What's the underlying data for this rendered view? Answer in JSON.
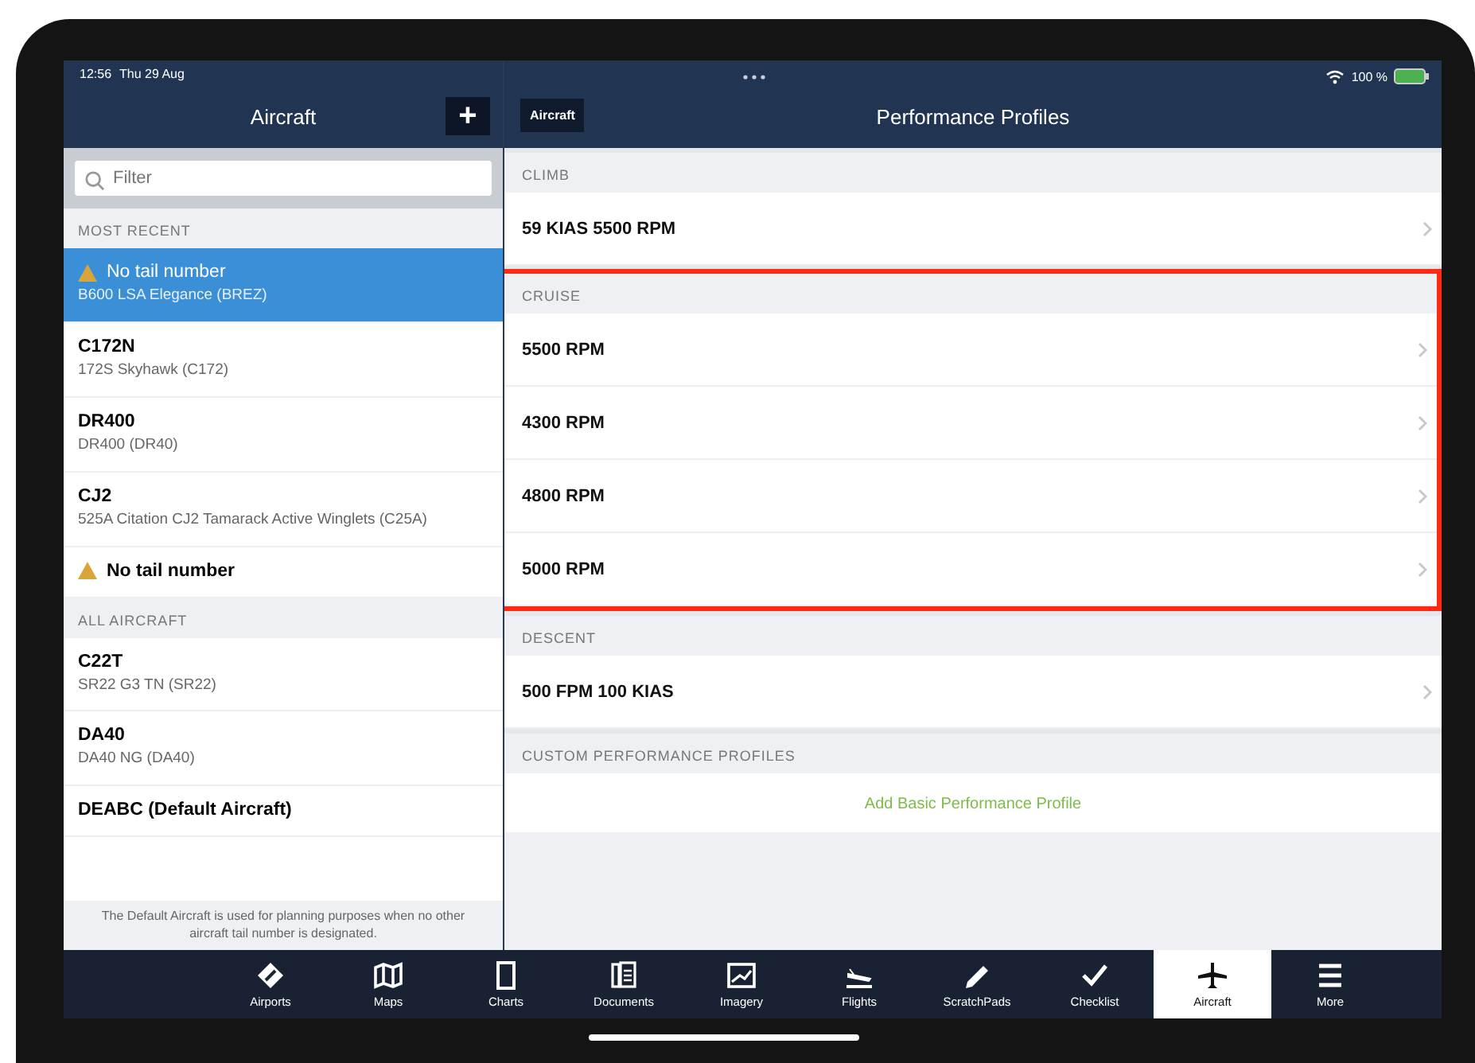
{
  "status_bar": {
    "time": "12:56",
    "date": "Thu 29 Aug",
    "battery": "100 %"
  },
  "sidebar": {
    "title": "Aircraft",
    "add_button": "+",
    "filter": {
      "placeholder": "Filter"
    },
    "sections": [
      {
        "heading": "MOST RECENT",
        "items": [
          {
            "title": "No tail number",
            "subtitle": "B600 LSA Elegance (BREZ)",
            "warning": true,
            "selected": true
          },
          {
            "title": "C172N",
            "subtitle": "172S Skyhawk (C172)",
            "warning": false,
            "selected": false
          },
          {
            "title": "DR400",
            "subtitle": "DR400 (DR40)",
            "warning": false,
            "selected": false
          },
          {
            "title": "CJ2",
            "subtitle": "525A Citation CJ2 Tamarack Active Winglets (C25A)",
            "warning": false,
            "selected": false
          },
          {
            "title": "No tail number",
            "warning": true,
            "selected": false
          }
        ]
      },
      {
        "heading": "ALL AIRCRAFT",
        "items": [
          {
            "title": "C22T",
            "subtitle": "SR22 G3 TN (SR22)",
            "warning": false,
            "selected": false
          },
          {
            "title": "DA40",
            "subtitle": "DA40 NG (DA40)",
            "warning": false,
            "selected": false
          },
          {
            "title": "DEABC (Default Aircraft)",
            "warning": false,
            "selected": false
          }
        ]
      }
    ],
    "footnote": "The Default Aircraft is used for planning purposes when no other aircraft tail number is designated."
  },
  "detail": {
    "title": "Performance Profiles",
    "back_button": "Aircraft",
    "sections": [
      {
        "heading": "CLIMB",
        "highlighted": false,
        "rows": [
          "59 KIAS 5500 RPM"
        ]
      },
      {
        "heading": "CRUISE",
        "highlighted": true,
        "rows": [
          "5500 RPM",
          "4300 RPM",
          "4800 RPM",
          "5000 RPM"
        ]
      },
      {
        "heading": "DESCENT",
        "highlighted": false,
        "rows": [
          "500 FPM 100 KIAS"
        ]
      }
    ],
    "custom_heading": "CUSTOM PERFORMANCE PROFILES",
    "add_link": "Add Basic Performance Profile"
  },
  "tab_bar": [
    {
      "kind": "airports",
      "label": "Airports",
      "selected": false
    },
    {
      "kind": "maps",
      "label": "Maps",
      "selected": false
    },
    {
      "kind": "charts",
      "label": "Charts",
      "selected": false
    },
    {
      "kind": "documents",
      "label": "Documents",
      "selected": false
    },
    {
      "kind": "imagery",
      "label": "Imagery",
      "selected": false
    },
    {
      "kind": "flights",
      "label": "Flights",
      "selected": false
    },
    {
      "kind": "scratchpads",
      "label": "ScratchPads",
      "selected": false
    },
    {
      "kind": "checklist",
      "label": "Checklist",
      "selected": false
    },
    {
      "kind": "aircraft",
      "label": "Aircraft",
      "selected": true
    },
    {
      "kind": "more",
      "label": "More",
      "selected": false
    }
  ]
}
